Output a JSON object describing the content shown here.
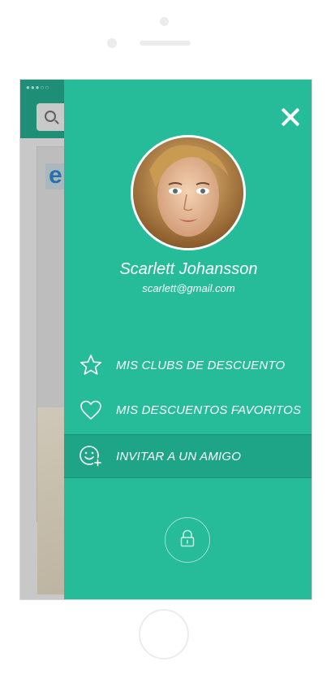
{
  "background_app": {
    "status_text": "●●●○○"
  },
  "menu": {
    "profile": {
      "name": "Scarlett Johansson",
      "email": "scarlett@gmail.com"
    },
    "items": [
      {
        "label": "MIS CLUBS DE DESCUENTO",
        "icon": "star-icon"
      },
      {
        "label": "MIS DESCUENTOS FAVORITOS",
        "icon": "heart-icon"
      },
      {
        "label": "INVITAR A UN AMIGO",
        "icon": "smiley-add-icon",
        "active": true
      }
    ],
    "lock_icon": "lock-icon",
    "close_icon": "close-icon"
  },
  "colors": {
    "menu_background": "#26bc9a",
    "active_item_background": "#1ea487",
    "header_background": "#1e8f76"
  }
}
